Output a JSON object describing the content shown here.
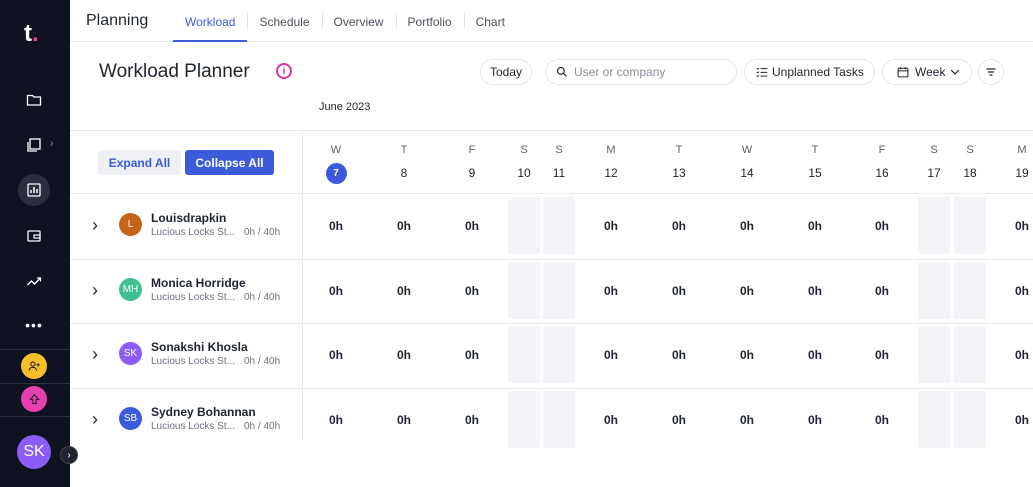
{
  "app": {
    "logo": "t",
    "logo_dot": "."
  },
  "header": {
    "title": "Planning",
    "tabs": [
      {
        "label": "Workload",
        "active": true
      },
      {
        "label": "Schedule"
      },
      {
        "label": "Overview"
      },
      {
        "label": "Portfolio"
      },
      {
        "label": "Chart"
      }
    ]
  },
  "sidebar": {
    "icons": [
      "folder-icon",
      "projects-icon",
      "dashboard-icon",
      "wallet-icon",
      "trend-icon",
      "more-icon"
    ],
    "active_icon": "dashboard-icon",
    "user_initials": "SK",
    "colors": {
      "bg": "#0f1221",
      "badge_yellow": "#f5c02a",
      "badge_pink": "#e83fb0",
      "avatar": "#8b5cf6"
    }
  },
  "page": {
    "title": "Workload Planner",
    "info": "i",
    "today_label": "Today",
    "search_placeholder": "User or company",
    "unplanned_label": "Unplanned Tasks",
    "week_label": "Week",
    "month": "June 2023",
    "expand_all": "Expand All",
    "collapse_all": "Collapse All"
  },
  "days": [
    {
      "dow": "W",
      "num": "7",
      "today": true
    },
    {
      "dow": "T",
      "num": "8"
    },
    {
      "dow": "F",
      "num": "9"
    },
    {
      "dow": "S",
      "num": "10",
      "weekend": true
    },
    {
      "dow": "S",
      "num": "11",
      "weekend": true
    },
    {
      "dow": "M",
      "num": "12"
    },
    {
      "dow": "T",
      "num": "13"
    },
    {
      "dow": "W",
      "num": "14"
    },
    {
      "dow": "T",
      "num": "15"
    },
    {
      "dow": "F",
      "num": "16"
    },
    {
      "dow": "S",
      "num": "17",
      "weekend": true
    },
    {
      "dow": "S",
      "num": "18",
      "weekend": true
    },
    {
      "dow": "M",
      "num": "19"
    }
  ],
  "users": [
    {
      "name": "Louisdrapkin",
      "initials": "L",
      "color": "#c8631a",
      "company": "Lucious Locks St...",
      "capacity": "0h / 40h",
      "hours": [
        "0h",
        "0h",
        "0h",
        "",
        "",
        "0h",
        "0h",
        "0h",
        "0h",
        "0h",
        "",
        "",
        "0h"
      ]
    },
    {
      "name": "Monica Horridge",
      "initials": "MH",
      "color": "#3ec18e",
      "company": "Lucious Locks St...",
      "capacity": "0h / 40h",
      "hours": [
        "0h",
        "0h",
        "0h",
        "",
        "",
        "0h",
        "0h",
        "0h",
        "0h",
        "0h",
        "",
        "",
        "0h"
      ]
    },
    {
      "name": "Sonakshi Khosla",
      "initials": "SK",
      "color": "#8b5cf6",
      "company": "Lucious Locks St...",
      "capacity": "0h / 40h",
      "hours": [
        "0h",
        "0h",
        "0h",
        "",
        "",
        "0h",
        "0h",
        "0h",
        "0h",
        "0h",
        "",
        "",
        "0h"
      ]
    },
    {
      "name": "Sydney Bohannan",
      "initials": "SB",
      "color": "#3b5bdb",
      "company": "Lucious Locks St...",
      "capacity": "0h / 40h",
      "hours": [
        "0h",
        "0h",
        "0h",
        "",
        "",
        "0h",
        "0h",
        "0h",
        "0h",
        "0h",
        "",
        "",
        "0h"
      ]
    }
  ]
}
